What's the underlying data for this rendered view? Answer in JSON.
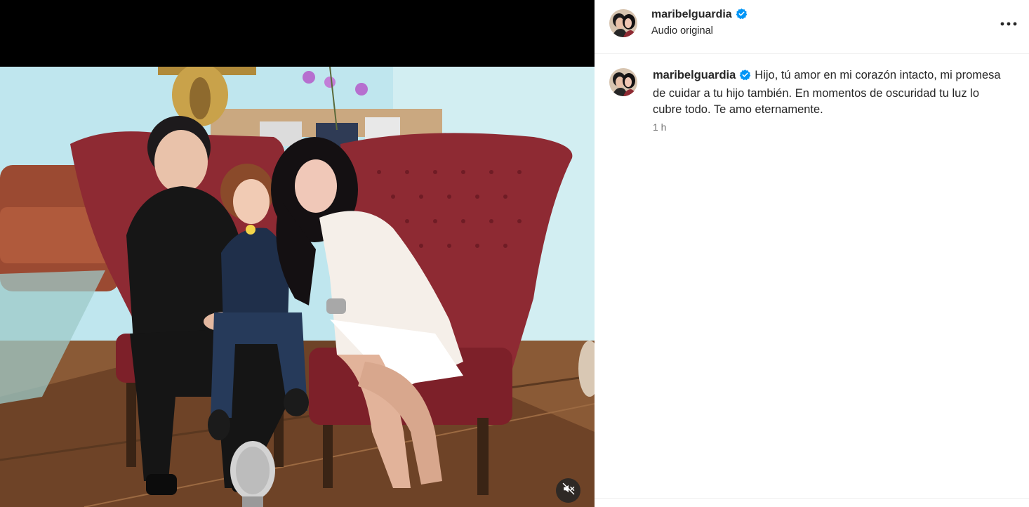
{
  "post": {
    "username": "maribelguardia",
    "audio_label": "Audio original",
    "caption": "Hijo, tú amor en mi corazón intacto, mi promesa de cuidar a tu hijo también. En momentos de oscuridad tu luz lo cubre todo. Te amo eternamente.",
    "time_ago": "1 h"
  },
  "icons": {
    "verified": "verified-badge-icon",
    "more": "more-options-icon",
    "mute": "audio-muted-icon"
  },
  "colors": {
    "verified_blue": "#0095f6",
    "chair_red": "#8e2a33",
    "text_secondary": "#737373"
  }
}
